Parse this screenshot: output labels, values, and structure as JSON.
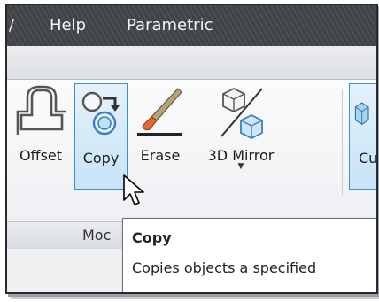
{
  "menubar": {
    "items": [
      {
        "label": "/"
      },
      {
        "label": "Help"
      },
      {
        "label": "Parametric"
      }
    ]
  },
  "ribbon": {
    "tools": [
      {
        "label": "Offset",
        "icon": "offset-icon"
      },
      {
        "label": "Copy",
        "icon": "copy-icon",
        "state": "hover"
      },
      {
        "label": "Erase",
        "icon": "erase-icon"
      },
      {
        "label": "3D Mirror",
        "icon": "3d-mirror-icon",
        "has_dropdown": true
      },
      {
        "label": "Cu",
        "icon": "box-icon"
      }
    ],
    "panel_title": "Moc"
  },
  "tooltip": {
    "title": "Copy",
    "description": "Copies objects a specified"
  },
  "colors": {
    "menubar_bg": "#45484c",
    "hover_fill": "#c7e3f7",
    "hover_border": "#3f8fcf",
    "tooltip_bg": "#ffffff"
  }
}
